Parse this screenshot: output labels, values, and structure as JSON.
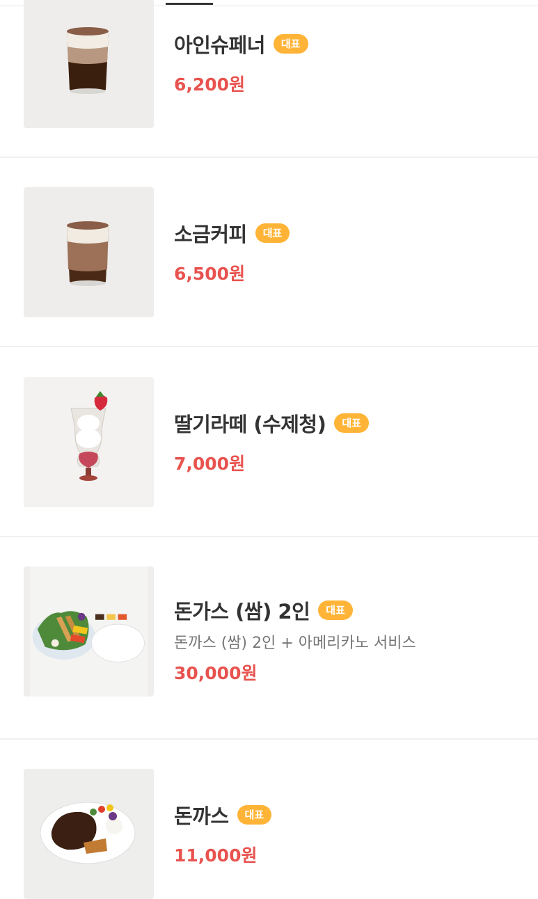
{
  "badge_label": "대표",
  "items": [
    {
      "name": "아인슈페너",
      "badge": "대표",
      "price": "6,200원",
      "image_icon": "coffee-cup-image"
    },
    {
      "name": "소금커피",
      "badge": "대표",
      "price": "6,500원",
      "image_icon": "coffee-cup-image"
    },
    {
      "name": "딸기라떼 (수제청)",
      "badge": "대표",
      "price": "7,000원",
      "image_icon": "strawberry-latte-image"
    },
    {
      "name": "돈가스 (쌈) 2인",
      "badge": "대표",
      "description": "돈까스 (쌈) 2인 + 아메리카노 서비스",
      "price": "30,000원",
      "image_icon": "tonkatsu-platter-image"
    },
    {
      "name": "돈까스",
      "badge": "대표",
      "price": "11,000원",
      "image_icon": "tonkatsu-plate-image"
    }
  ],
  "colors": {
    "badge": "#ffb437",
    "price": "#e8534f",
    "name": "#333333",
    "divider": "#f0f0f0"
  }
}
